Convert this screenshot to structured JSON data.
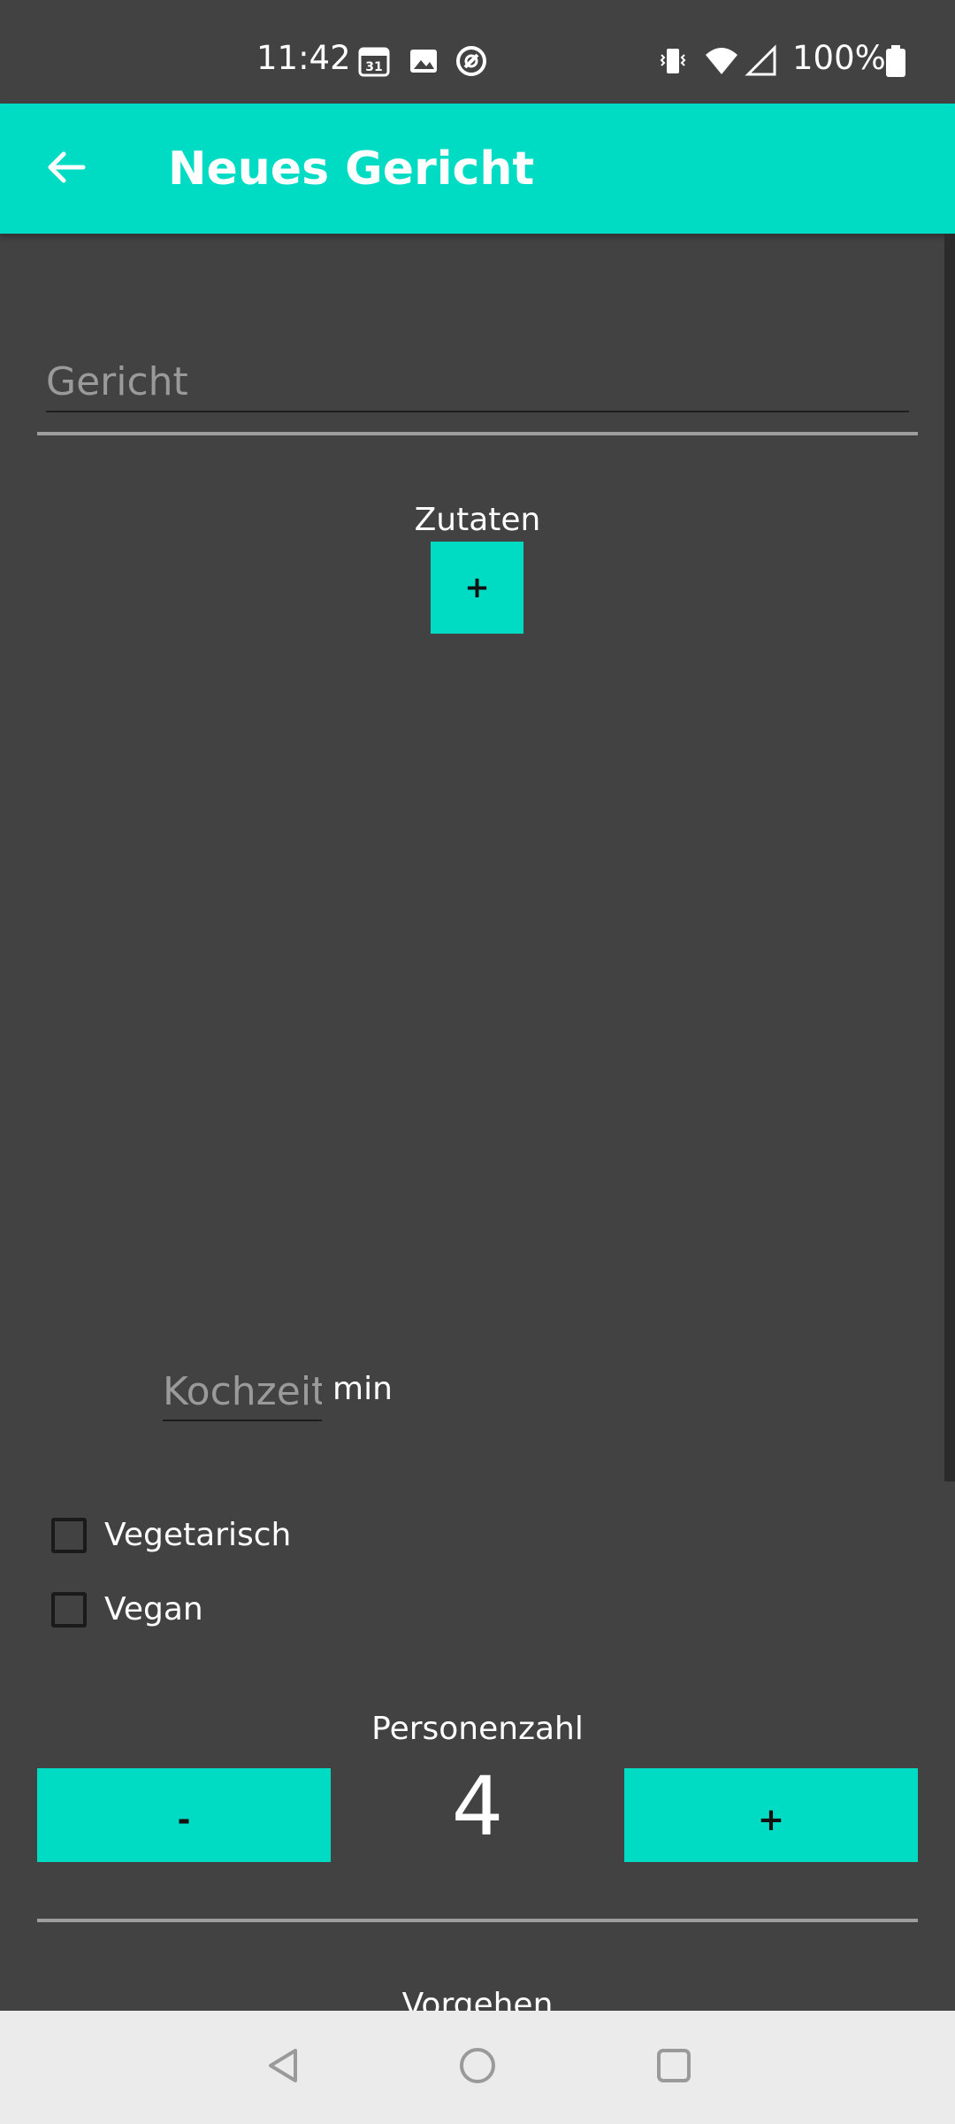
{
  "status_bar": {
    "time": "11:42",
    "battery_percent": "100%",
    "icons": [
      "calendar-icon",
      "image-icon",
      "sync-icon",
      "vibrate-icon",
      "wifi-icon",
      "signal-icon",
      "battery-icon"
    ]
  },
  "app_bar": {
    "title": "Neues Gericht",
    "back_icon": "arrow-back-icon",
    "color": "#00dbc4"
  },
  "form": {
    "gericht_placeholder": "Gericht",
    "zutaten_label": "Zutaten",
    "add_ingredient_label": "+",
    "kochzeit_placeholder": "Kochzeit",
    "kochzeit_unit": "min",
    "checkboxes": [
      {
        "label": "Vegetarisch",
        "checked": false
      },
      {
        "label": "Vegan",
        "checked": false
      }
    ],
    "personen_label": "Personenzahl",
    "personen_value": "4",
    "decrement_label": "-",
    "increment_label": "+",
    "vorgehen_label": "Vorgehen"
  },
  "nav_bar": {
    "icons": [
      "back-triangle-icon",
      "home-circle-icon",
      "recents-square-icon"
    ]
  },
  "colors": {
    "background": "#424242",
    "accent": "#00dbc4",
    "divider": "#9e9e9e",
    "nav_background": "#ebebeb"
  }
}
